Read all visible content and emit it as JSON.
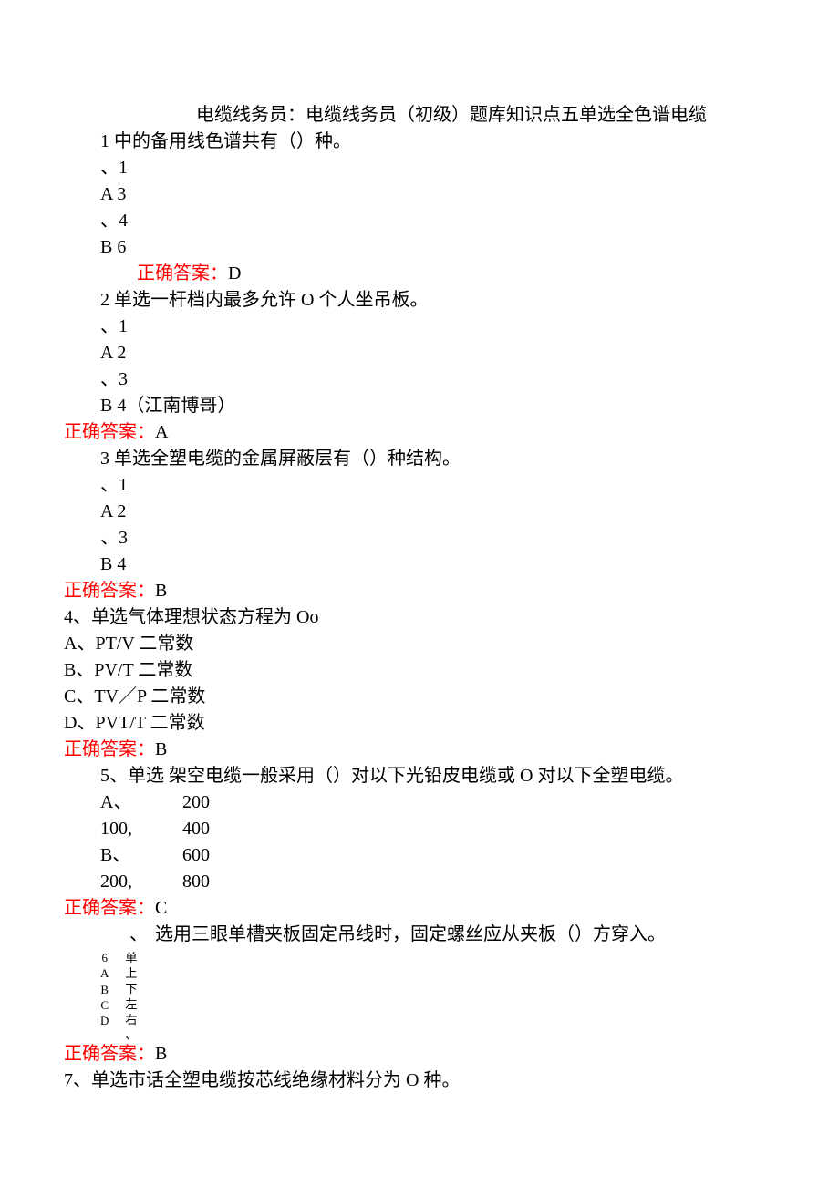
{
  "title_line1": "电缆线务员：电缆线务员（初级）题库知识点五单选全色谱电缆",
  "q1": {
    "num": "1",
    "text": "中的备用线色谱共有（）种。",
    "opt_p1": "、1",
    "opt_A": "A 3",
    "opt_p2": "、4",
    "opt_B": "B 6",
    "answer_label": "正确答案：",
    "answer_val": "D"
  },
  "q2": {
    "line": "2 单选一杆档内最多允许 O 个人坐吊板。",
    "opt_p1": "、1",
    "opt_A": "A 2",
    "opt_p2": "、3",
    "opt_B": "B 4（江南博哥）",
    "answer_label": "正确答案：",
    "answer_val": "A"
  },
  "q3": {
    "line": "3 单选全塑电缆的金属屏蔽层有（）种结构。",
    "opt_p1": "、1",
    "opt_A": "A 2",
    "opt_p2": "、3",
    "opt_B": "B 4",
    "answer_label": "正确答案：",
    "answer_val": "B"
  },
  "q4": {
    "line": "4、单选气体理想状态方程为 Oo",
    "optA": "A、PT/V 二常数",
    "optB": "B、PV/T 二常数",
    "optC": "C、TV／P 二常数",
    "optD": "D、PVT/T 二常数",
    "answer_label": "正确答案：",
    "answer_val": "B"
  },
  "q5": {
    "line": "5、单选 架空电缆一般采用（）对以下光铅皮电缆或 O 对以下全塑电缆。",
    "row1l": "A、",
    "row1r": "200",
    "row2l": "100,",
    "row2r": "400",
    "row3l": "B、",
    "row3r": "600",
    "row4l": "200,",
    "row4r": "800",
    "answer_label": "正确答案：",
    "answer_val": "C"
  },
  "q6": {
    "comma": "、",
    "intro": "选用三眼单槽夹板固定吊线时，固定螺丝应从夹板（）方穿入。",
    "idx_chars": [
      "6",
      "A",
      "B",
      "C",
      "D"
    ],
    "opt_chars": [
      "单",
      "上",
      "下",
      "左",
      "右",
      "、"
    ],
    "answer_label": "正确答案：",
    "answer_val": "B"
  },
  "q7": {
    "line": "7、单选市话全塑电缆按芯线绝缘材料分为 O 种。"
  }
}
